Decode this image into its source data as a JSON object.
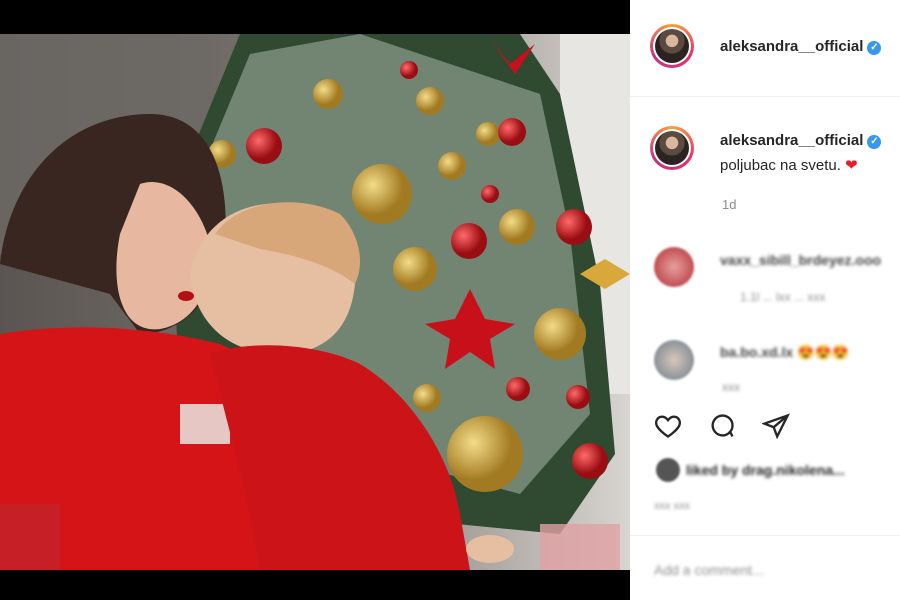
{
  "post": {
    "username": "aleksandra__official",
    "caption": "poljubac na svetu.",
    "caption_emoji": "❤",
    "time_ago": "1d"
  },
  "comments": [
    {
      "user": "vaxx_sibill_brdeyez.ooo",
      "meta": "1.1l ... lxx ... xxx"
    },
    {
      "user": "ba.bo.xd.lx",
      "emoji": "😍😍😍",
      "meta": "xxx"
    }
  ],
  "likes_text": "liked by drag.nikolena...",
  "date_text": "xxx xxx",
  "add_comment": "Add a comment...",
  "icons": [
    "heart-icon",
    "comment-icon",
    "share-icon"
  ],
  "colors": {
    "instagram_blue": "#3897f0",
    "heart_red": "#ed1c24"
  }
}
